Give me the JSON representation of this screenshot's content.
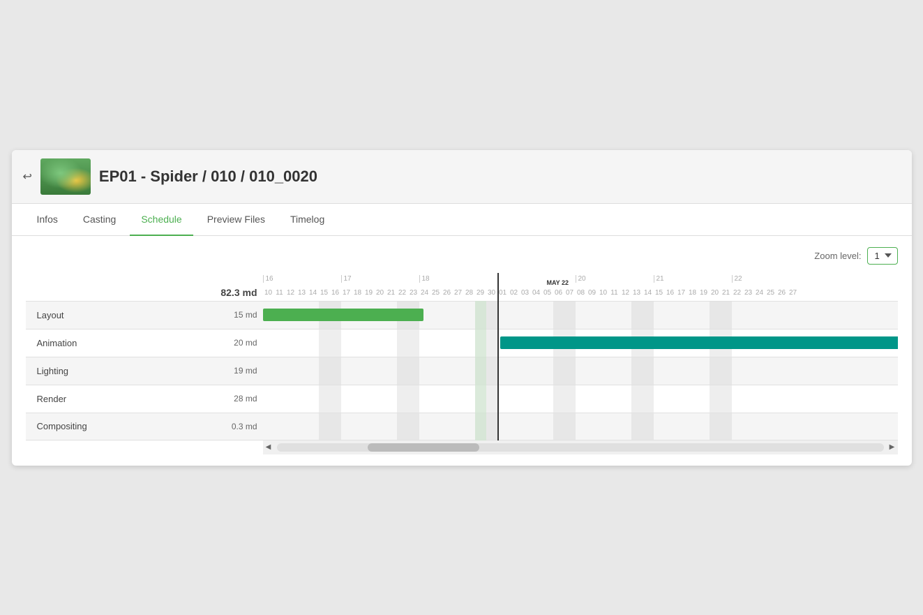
{
  "header": {
    "title": "EP01 - Spider / 010 / 010_0020",
    "back_icon": "←"
  },
  "tabs": [
    {
      "id": "infos",
      "label": "Infos",
      "active": false
    },
    {
      "id": "casting",
      "label": "Casting",
      "active": false
    },
    {
      "id": "schedule",
      "label": "Schedule",
      "active": true
    },
    {
      "id": "preview_files",
      "label": "Preview Files",
      "active": false
    },
    {
      "id": "timelog",
      "label": "Timelog",
      "active": false
    }
  ],
  "zoom": {
    "label": "Zoom level:",
    "value": "1"
  },
  "gantt": {
    "total_md": "82.3 md",
    "rows": [
      {
        "label": "Layout",
        "md": "15 md",
        "even": true
      },
      {
        "label": "Animation",
        "md": "20 md",
        "even": false
      },
      {
        "label": "Lighting",
        "md": "19 md",
        "even": true
      },
      {
        "label": "Render",
        "md": "28 md",
        "even": false
      },
      {
        "label": "Compositing",
        "md": "0.3 md",
        "even": true
      }
    ],
    "today_label": "MAY 22"
  }
}
